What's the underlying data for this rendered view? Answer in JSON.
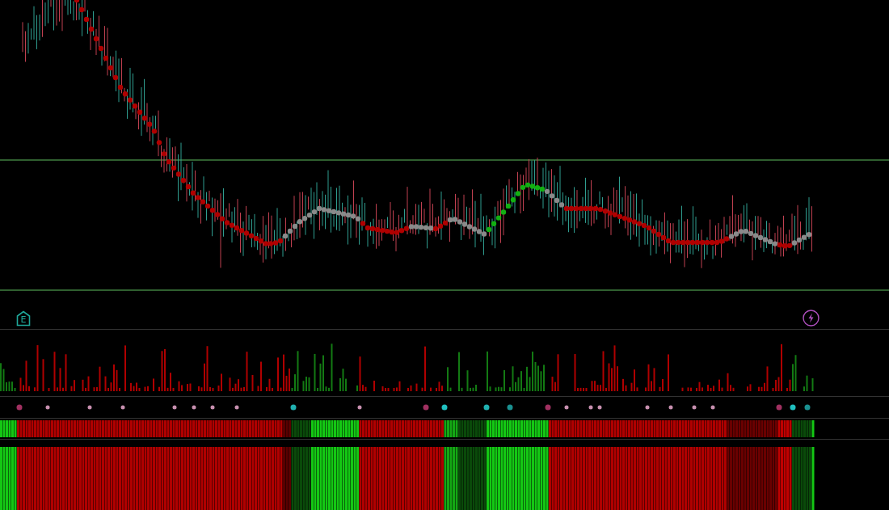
{
  "price_panel": {
    "kind": "candles"
  },
  "markers": {
    "earnings": {
      "label": "E"
    },
    "event": {
      "kind": "lightning"
    }
  },
  "indicator_panels": [
    {
      "kind": "volume"
    },
    {
      "kind": "dots"
    },
    {
      "kind": "strip"
    },
    {
      "kind": "strip"
    }
  ]
}
